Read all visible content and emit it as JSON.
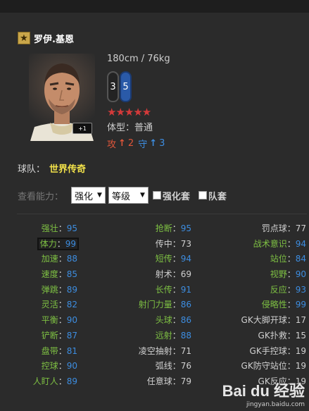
{
  "player": {
    "name": "罗伊.基恩",
    "height_weight": "180cm / 76kg",
    "left_foot": "3",
    "right_foot": "5",
    "stars": "★★★★★",
    "level_badge": "+1",
    "body_type": "体型：普通",
    "attack_label": "攻",
    "attack_value": "2",
    "defense_label": "守",
    "defense_value": "3"
  },
  "team": {
    "label": "球队：",
    "name": "世界传奇"
  },
  "controls": {
    "label": "查看能力：",
    "select1": "强化",
    "select2": "等级",
    "checkbox1": "强化套",
    "checkbox2": "队套"
  },
  "stats_col1": [
    {
      "label": "强壮",
      "value": "95"
    },
    {
      "label": "体力",
      "value": "99"
    },
    {
      "label": "加速",
      "value": "88"
    },
    {
      "label": "速度",
      "value": "85"
    },
    {
      "label": "弹跳",
      "value": "89"
    },
    {
      "label": "灵活",
      "value": "82"
    },
    {
      "label": "平衡",
      "value": "90"
    },
    {
      "label": "铲断",
      "value": "87"
    },
    {
      "label": "盘带",
      "value": "81"
    },
    {
      "label": "控球",
      "value": "90"
    },
    {
      "label": "人盯人",
      "value": "89"
    }
  ],
  "stats_col2": [
    {
      "label": "抢断",
      "value": "95"
    },
    {
      "label": "传中",
      "value": "73"
    },
    {
      "label": "短传",
      "value": "94"
    },
    {
      "label": "射术",
      "value": "69"
    },
    {
      "label": "长传",
      "value": "91"
    },
    {
      "label": "射门力量",
      "value": "86"
    },
    {
      "label": "头球",
      "value": "86"
    },
    {
      "label": "远射",
      "value": "88"
    },
    {
      "label": "凌空抽射",
      "value": "71"
    },
    {
      "label": "弧线",
      "value": "76"
    },
    {
      "label": "任意球",
      "value": "79"
    }
  ],
  "stats_col3": [
    {
      "label": "罚点球",
      "value": "77"
    },
    {
      "label": "战术意识",
      "value": "94"
    },
    {
      "label": "站位",
      "value": "84"
    },
    {
      "label": "视野",
      "value": "90"
    },
    {
      "label": "反应",
      "value": "93"
    },
    {
      "label": "侵略性",
      "value": "99"
    },
    {
      "label": "GK大脚开球",
      "value": "17"
    },
    {
      "label": "GK扑救",
      "value": "15"
    },
    {
      "label": "GK手控球",
      "value": "19"
    },
    {
      "label": "GK防守站位",
      "value": "19"
    },
    {
      "label": "GK反应",
      "value": "19"
    }
  ],
  "watermark": {
    "logo": "Bai du 经验",
    "url": "jingyan.baidu.com"
  },
  "colors": {
    "green_label": "#7ec043",
    "blue_value": "#3d8de0",
    "team_gold": "#f3e24a",
    "star_red": "#d43a3a"
  }
}
